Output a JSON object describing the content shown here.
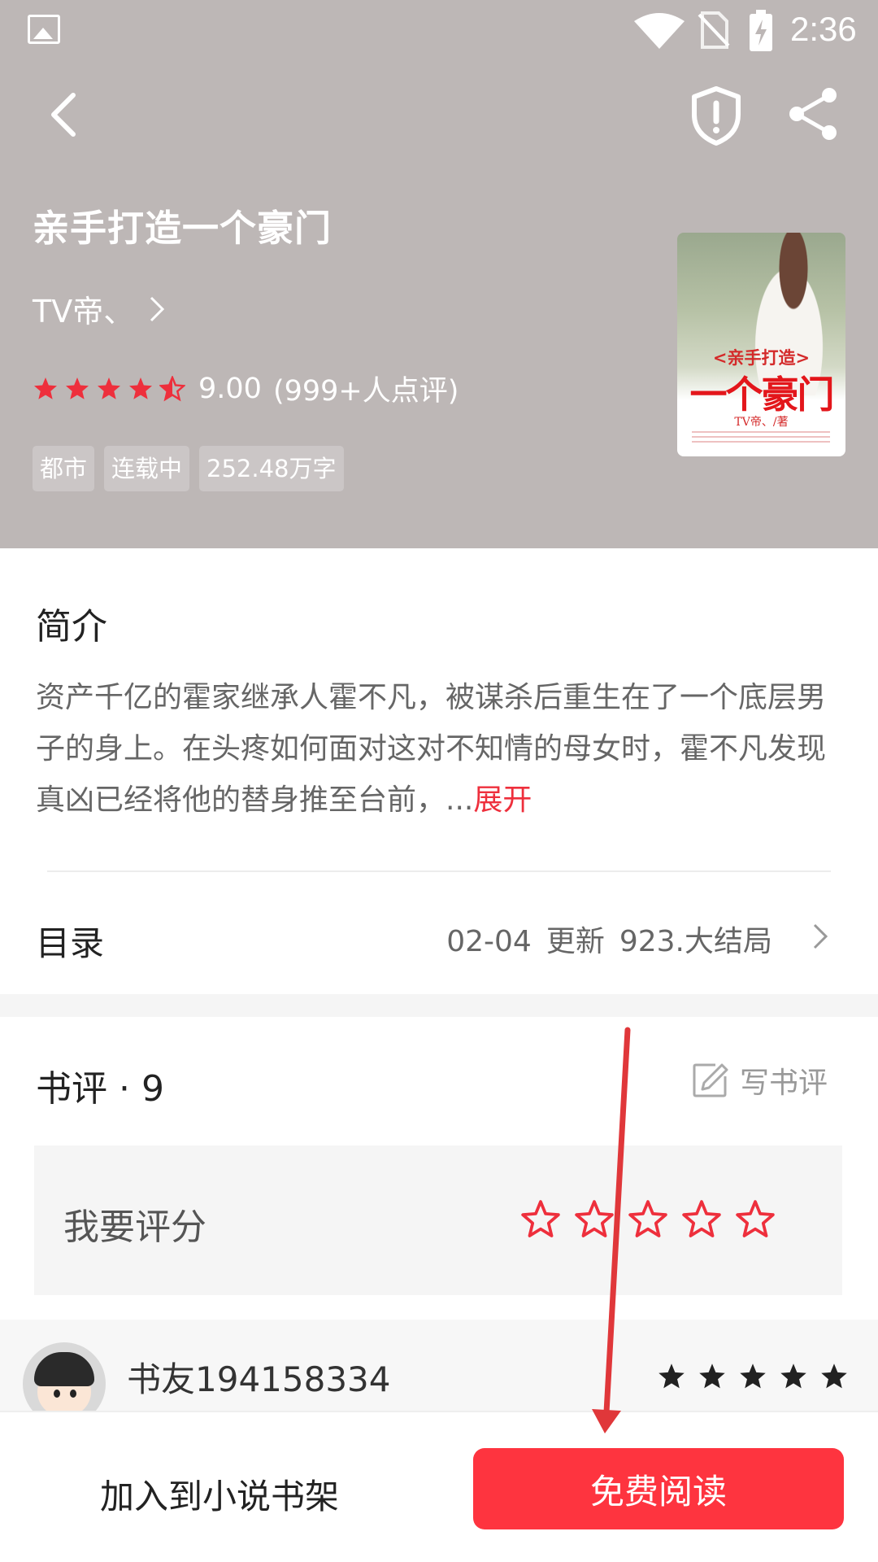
{
  "status_bar": {
    "time": "2:36"
  },
  "book": {
    "title": "亲手打造一个豪门",
    "author": "TV帝、",
    "score": "9.00",
    "review_count": "(999+人点评)",
    "rating_stars": 4.5,
    "tags": [
      "都市",
      "连载中",
      "252.48万字"
    ],
    "cover": {
      "line1": "<亲手打造>",
      "line2": "一个豪门",
      "line3": "TV帝、/著"
    }
  },
  "intro": {
    "title": "简介",
    "text": "资产千亿的霍家继承人霍不凡，被谋杀后重生在了一个底层男子的身上。在头疼如何面对这对不知情的母女时，霍不凡发现真凶已经将他的替身推至台前，...",
    "expand_label": "展开"
  },
  "toc": {
    "label": "目录",
    "date": "02-04",
    "update_label": "更新",
    "latest_chapter": "923.大结局"
  },
  "reviews": {
    "title": "书评 · 9",
    "write_label": "写书评",
    "my_rating_label": "我要评分",
    "items": [
      {
        "user": "书友194158334",
        "stars": 5
      }
    ]
  },
  "bottom": {
    "add_shelf_label": "加入到小说书架",
    "read_label": "免费阅读"
  },
  "colors": {
    "accent": "#fe343f",
    "header_bg": "#bdb7b6",
    "star_red": "#ee2f3c"
  }
}
